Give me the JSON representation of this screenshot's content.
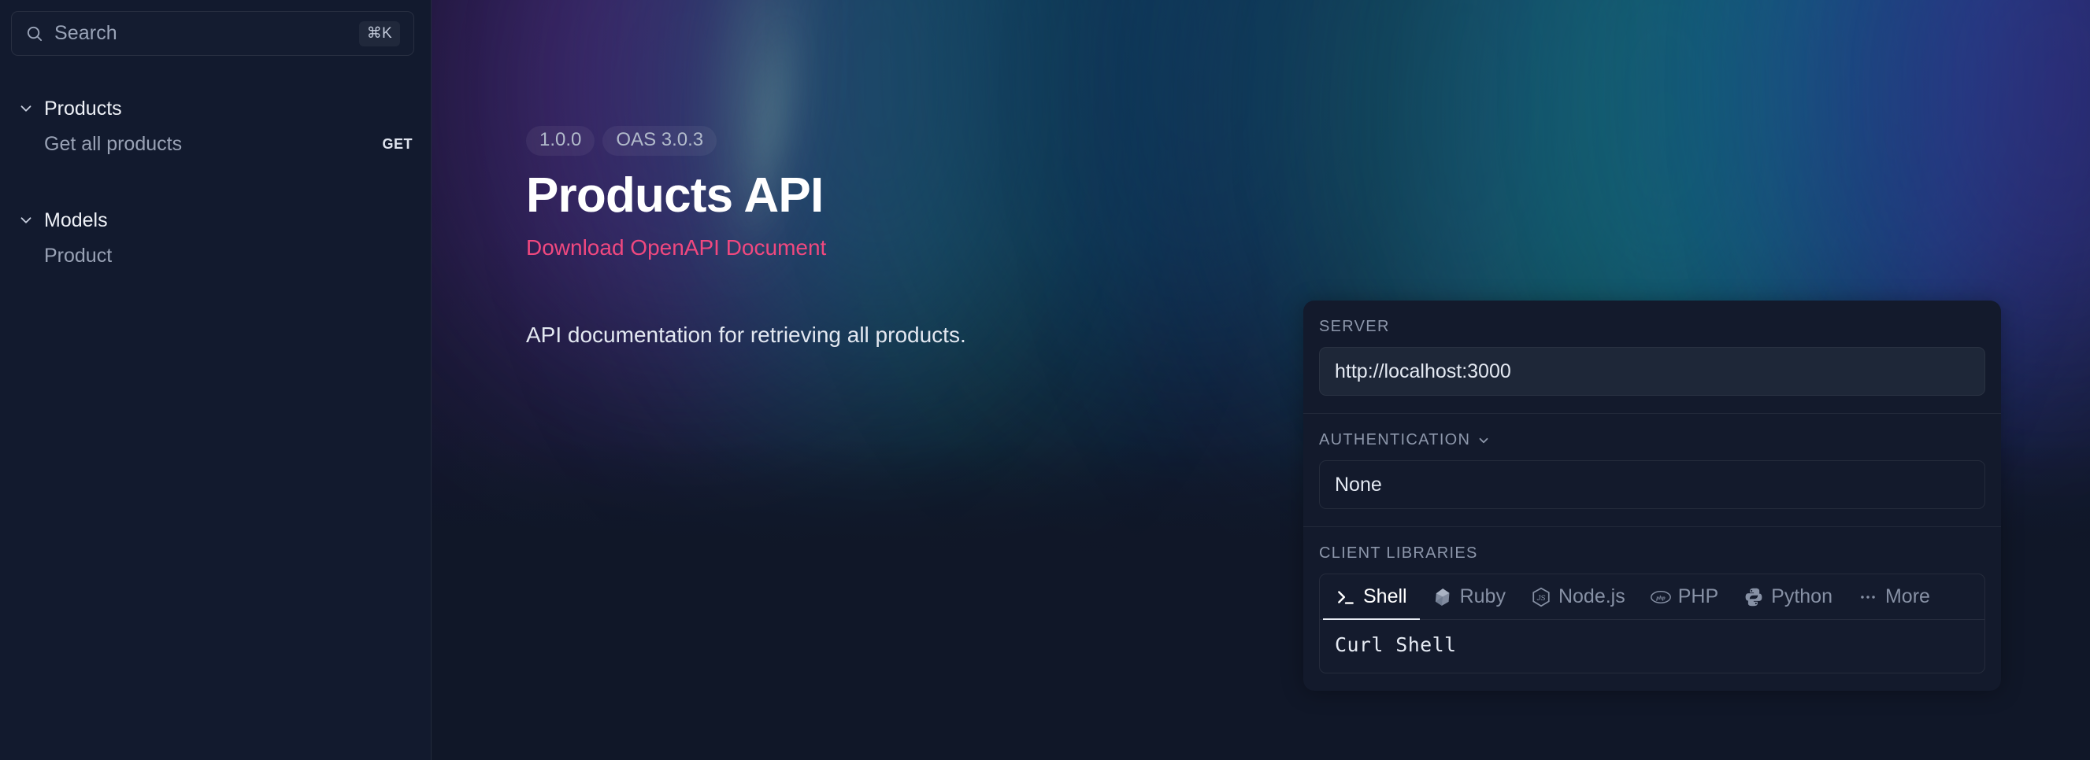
{
  "sidebar": {
    "search": {
      "placeholder": "Search",
      "shortcut": "⌘K",
      "icon": "search-icon"
    },
    "groups": [
      {
        "label": "Products",
        "icon": "chevron-down-icon",
        "items": [
          {
            "label": "Get all products",
            "method": "GET"
          }
        ]
      },
      {
        "label": "Models",
        "icon": "chevron-down-icon",
        "items": [
          {
            "label": "Product",
            "method": ""
          }
        ]
      }
    ]
  },
  "document": {
    "badges": [
      "1.0.0",
      "OAS 3.0.3"
    ],
    "title": "Products API",
    "download_link": "Download OpenAPI Document",
    "description": "API documentation for retrieving all products."
  },
  "panel": {
    "server": {
      "label": "SERVER",
      "value": "http://localhost:3000"
    },
    "authentication": {
      "label": "AUTHENTICATION",
      "chevron": "chevron-down-icon",
      "value": "None"
    },
    "client_libraries": {
      "label": "CLIENT LIBRARIES",
      "tabs": [
        {
          "label": "Shell",
          "icon": "terminal-icon",
          "active": true
        },
        {
          "label": "Ruby",
          "icon": "ruby-icon",
          "active": false
        },
        {
          "label": "Node.js",
          "icon": "nodejs-icon",
          "active": false
        },
        {
          "label": "PHP",
          "icon": "php-icon",
          "active": false
        },
        {
          "label": "Python",
          "icon": "python-icon",
          "active": false
        },
        {
          "label": "More",
          "icon": "ellipsis-icon",
          "active": false
        }
      ],
      "body": "Curl Shell"
    }
  },
  "colors": {
    "accent_pink": "#f0487f",
    "background": "#101728",
    "sidebar": "#121a2e",
    "panel": "#131a2c",
    "field": "#1e2738"
  }
}
